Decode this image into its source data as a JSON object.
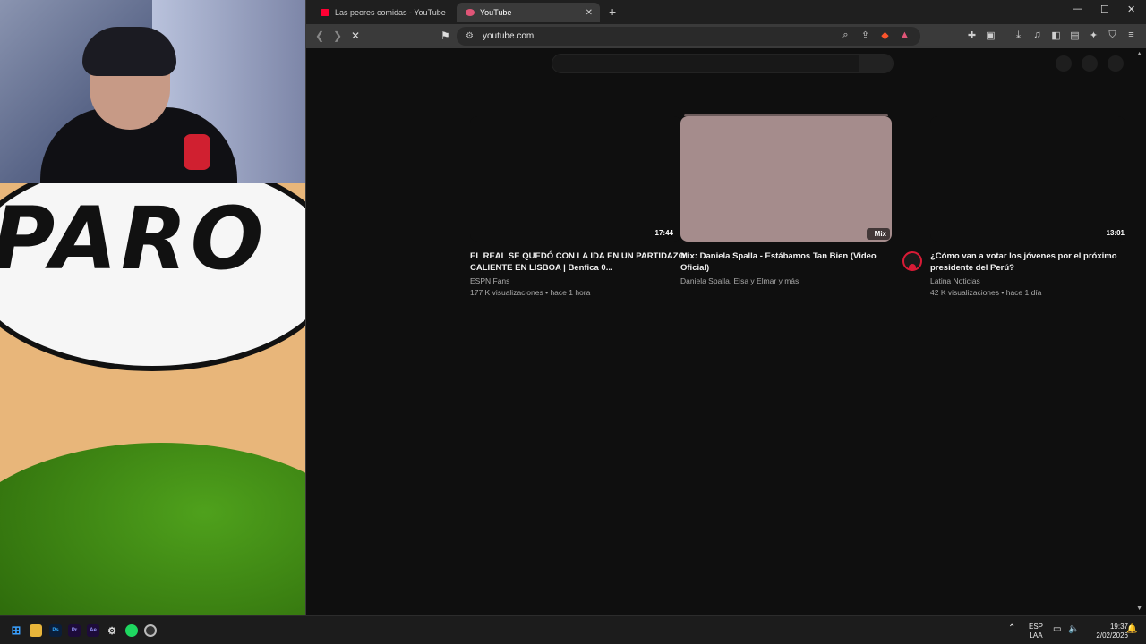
{
  "browser": {
    "tabs": [
      {
        "label": "Las peores comidas - YouTube",
        "active": false
      },
      {
        "label": "YouTube",
        "active": true
      }
    ],
    "url": "youtube.com"
  },
  "overlay": {
    "comic_text": "PARO"
  },
  "videos": [
    {
      "title": "EL REAL SE QUEDÓ CON LA IDA EN UN PARTIDAZO CALIENTE EN LISBOA | Benfica 0...",
      "channel": "ESPN Fans",
      "meta": "177 K visualizaciones • hace 1 hora",
      "duration": "17:44"
    },
    {
      "title": "Mix: Daniela Spalla - Estábamos Tan Bien (Video Oficial)",
      "channel": "Daniela Spalla, Elsa y Elmar y más",
      "meta": "",
      "duration": "Mix"
    },
    {
      "title": "¿Cómo van a votar los jóvenes por el próximo presidente del Perú?",
      "channel": "Latina Noticias",
      "meta": "42 K visualizaciones • hace 1 día",
      "duration": "13:01"
    }
  ],
  "taskbar": {
    "lang_top": "ESP",
    "lang_bottom": "LAA",
    "time": "19:37",
    "date": "2/02/2026"
  },
  "colors": {
    "yt_background": "#0f0f0f",
    "mix_thumb": "#a58c8c",
    "accent": "#ff0033"
  }
}
